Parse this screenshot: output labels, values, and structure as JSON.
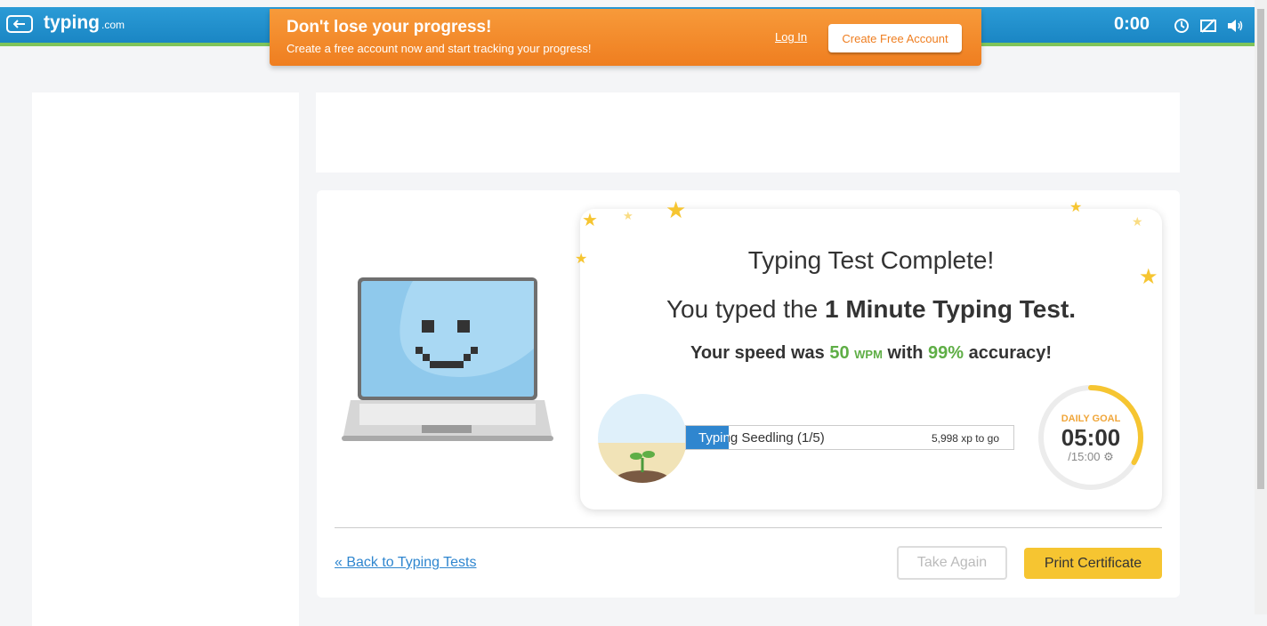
{
  "topbar": {
    "logo_main": "typing",
    "logo_sub": ".com",
    "timer": "0:00"
  },
  "banner": {
    "title": "Don't lose your progress!",
    "subtitle": "Create a free account now and start tracking your progress!",
    "login_label": "Log In",
    "create_label": "Create Free Account"
  },
  "results": {
    "title": "Typing Test Complete!",
    "line_prefix": "You typed the ",
    "line_bold": "1 Minute Typing Test.",
    "speed_prefix": "Your speed was ",
    "wpm_value": "50",
    "wpm_unit": "WPM",
    "speed_mid": " with ",
    "accuracy": "99%",
    "speed_suffix": " accuracy!"
  },
  "xp": {
    "label": "Typing Seedling (1/5)",
    "to_go": "5,998 xp to go",
    "progress": 0.13
  },
  "daily_goal": {
    "label": "DAILY GOAL",
    "time": "05:00",
    "total": "/15:00",
    "progress": 0.333
  },
  "footer": {
    "back_link": "« Back to Typing Tests",
    "take_again": "Take Again",
    "print_certificate": "Print Certificate"
  },
  "colors": {
    "brand_blue": "#1a86c4",
    "banner_orange": "#ef7e20",
    "accent_green": "#5fae46",
    "goal_yellow": "#f6c531"
  },
  "icons": [
    "back-arrow-icon",
    "history-icon",
    "hide-visuals-icon",
    "sound-icon",
    "settings-gear-icon"
  ]
}
